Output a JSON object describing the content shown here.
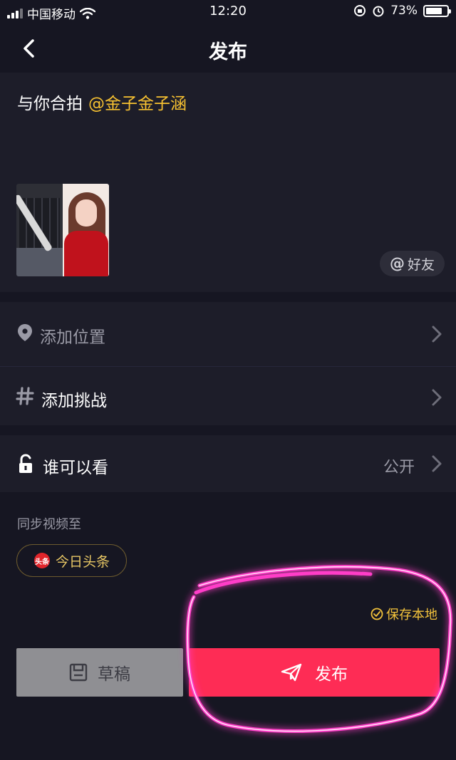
{
  "status_bar": {
    "carrier": "中国移动",
    "time": "12:20",
    "battery": "73%"
  },
  "nav": {
    "title": "发布"
  },
  "caption": {
    "text": "与你合拍",
    "mention": "@金子金子涵"
  },
  "friend_button": {
    "at": "@",
    "label": "好友"
  },
  "rows": {
    "location": {
      "label": "添加位置"
    },
    "challenge": {
      "label": "添加挑战"
    },
    "visibility": {
      "label": "谁可以看",
      "value": "公开"
    }
  },
  "sync": {
    "label": "同步视频至",
    "toutiao": {
      "logo_text": "头条",
      "label": "今日头条"
    }
  },
  "save_local": "保存本地",
  "buttons": {
    "draft": "草稿",
    "publish": "发布"
  },
  "colors": {
    "background": "#161622",
    "panel": "#1d1d29",
    "accent_yellow": "#f7c131",
    "publish_red": "#fe2c55",
    "highlight_pink": "#ff3cc8"
  },
  "icons": {
    "back": "chevron-left-icon",
    "location": "location-pin-icon",
    "challenge": "hashtag-icon",
    "visibility": "unlock-icon",
    "chevron": "chevron-right-icon",
    "save_local": "check-circle-icon",
    "draft": "draft-box-icon",
    "publish": "paper-plane-icon"
  }
}
